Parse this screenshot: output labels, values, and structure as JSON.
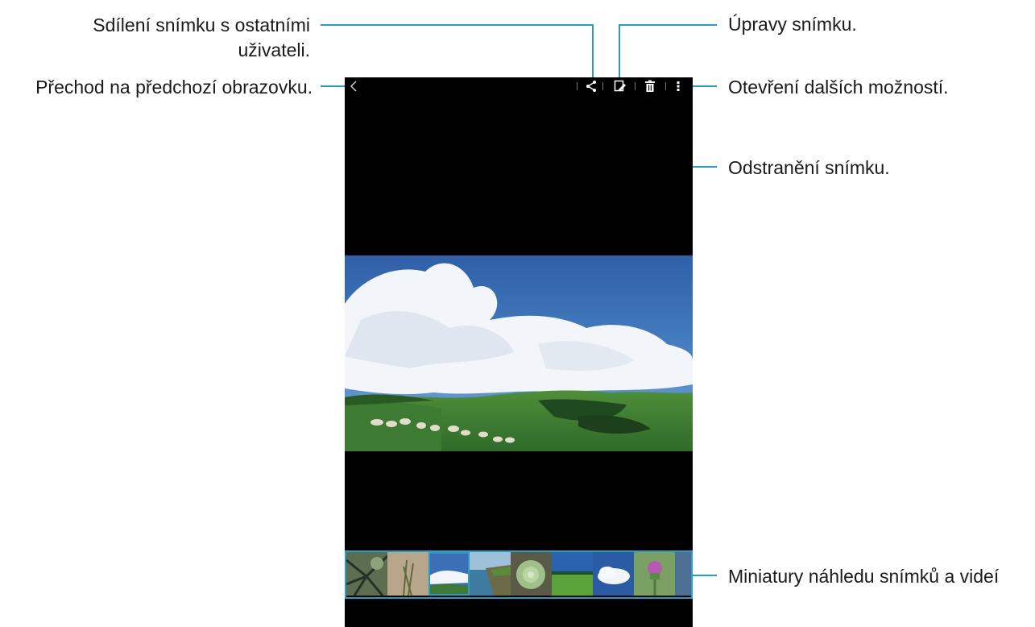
{
  "annotations": {
    "share": "Sdílení snímku s ostatními uživateli.",
    "back": "Přechod na předchozí obrazovku.",
    "edit": "Úpravy snímku.",
    "more": "Otevření dalších možností.",
    "delete": "Odstranění snímku.",
    "thumbnails": "Miniatury náhledu snímků a videí"
  },
  "toolbar": {
    "back_icon": "chevron-left-icon",
    "share_icon": "share-icon",
    "edit_icon": "edit-icon",
    "delete_icon": "trash-icon",
    "more_icon": "more-vertical-icon"
  },
  "thumbnails": [
    {
      "name": "tree",
      "selected": false
    },
    {
      "name": "grass",
      "selected": false
    },
    {
      "name": "sky-hills",
      "selected": true
    },
    {
      "name": "coast-cliff",
      "selected": false
    },
    {
      "name": "succulent",
      "selected": false
    },
    {
      "name": "green-field",
      "selected": false
    },
    {
      "name": "clouds",
      "selected": false
    },
    {
      "name": "thistle-flower",
      "selected": false
    }
  ],
  "colors": {
    "callout": "#2b9bc6",
    "screen_bg": "#000000",
    "text": "#1a1a1a"
  }
}
